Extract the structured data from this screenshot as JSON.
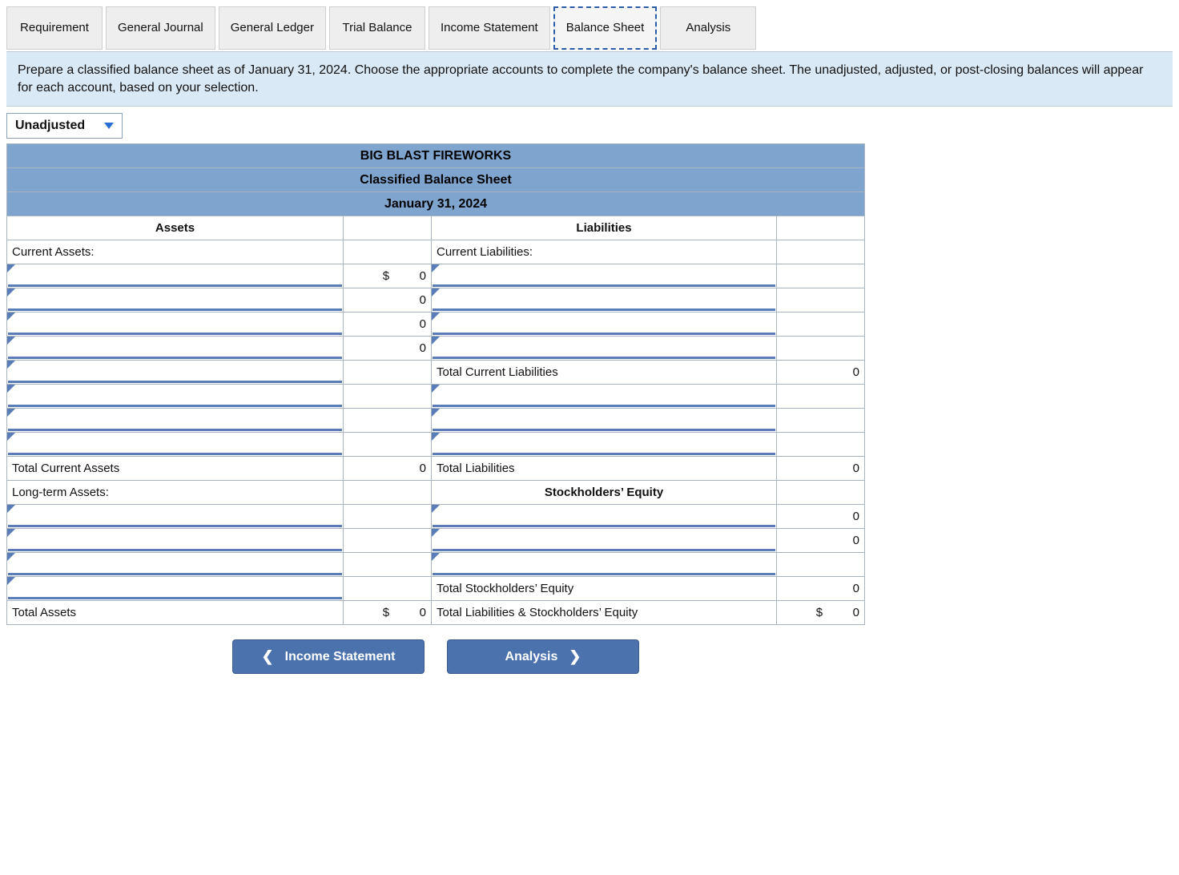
{
  "tabs": {
    "requirement": "Requirement",
    "general_journal": "General Journal",
    "general_ledger": "General Ledger",
    "trial_balance": "Trial Balance",
    "income_statement": "Income Statement",
    "balance_sheet": "Balance Sheet",
    "analysis": "Analysis"
  },
  "instructions": "Prepare a classified balance sheet as of January 31, 2024. Choose the appropriate accounts to complete the company's balance sheet. The unadjusted, adjusted, or post-closing balances will appear for each account, based on your selection.",
  "dropdown": {
    "selected": "Unadjusted"
  },
  "header": {
    "company": "BIG BLAST FIREWORKS",
    "title": "Classified Balance Sheet",
    "date": "January 31, 2024"
  },
  "sections": {
    "assets": "Assets",
    "liabilities": "Liabilities",
    "current_assets": "Current Assets:",
    "current_liabilities": "Current Liabilities:",
    "total_current_assets": "Total Current Assets",
    "total_current_liabilities": "Total Current Liabilities",
    "long_term_assets": "Long-term Assets:",
    "total_liabilities": "Total Liabilities",
    "stockholders_equity": "Stockholders’ Equity",
    "total_stockholders_equity": "Total Stockholders’ Equity",
    "total_assets": "Total Assets",
    "total_liab_equity": "Total Liabilities & Stockholders’ Equity"
  },
  "values": {
    "dollar": "$",
    "zero": "0",
    "ca1": "0",
    "ca2": "0",
    "ca3": "0",
    "ca4": "0",
    "tca": "0",
    "tcl": "0",
    "tl": "0",
    "se1": "0",
    "se2": "0",
    "tse": "0",
    "ta": "0",
    "tle": "0"
  },
  "nav": {
    "prev": "Income Statement",
    "next": "Analysis"
  }
}
